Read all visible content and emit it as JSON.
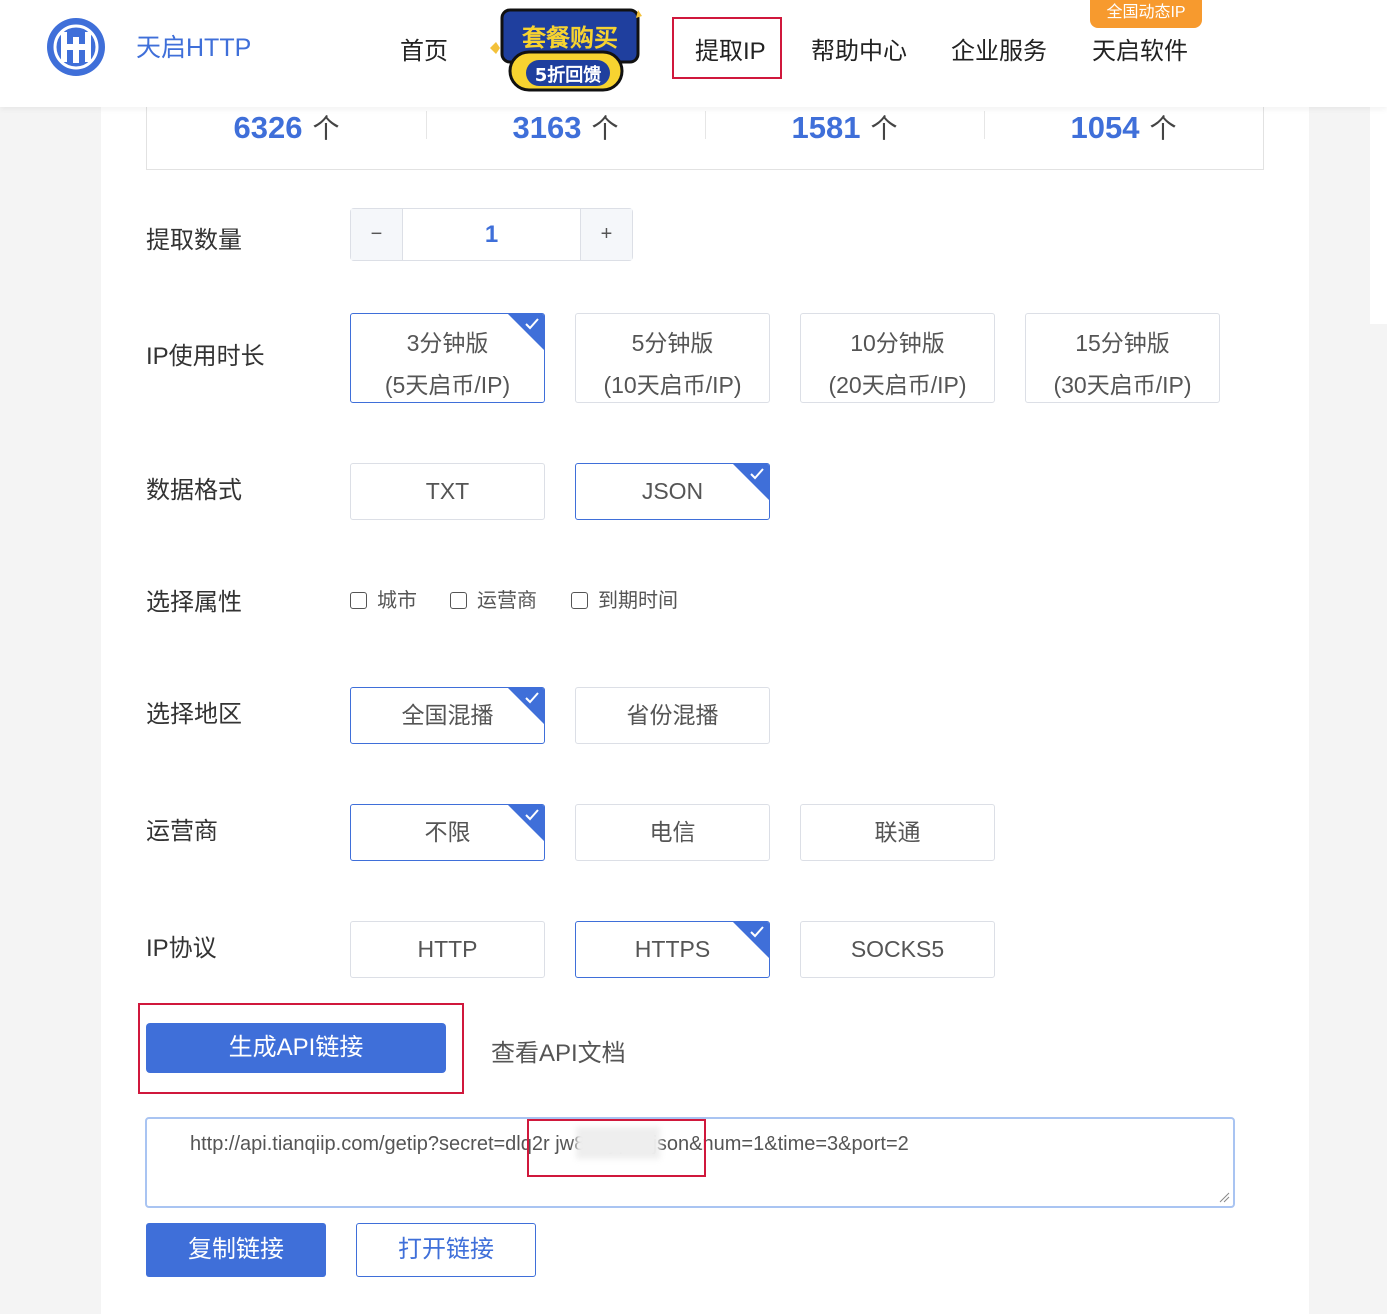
{
  "header": {
    "brand": "天启HTTP",
    "nav": [
      "首页",
      "提取IP",
      "帮助中心",
      "企业服务",
      "天启软件"
    ],
    "active_nav": "提取IP",
    "promo_line1": "套餐购买",
    "promo_line2": "5折回馈",
    "badge": "全国动态IP",
    "colors": {
      "accent": "#3f6fd9",
      "highlight": "#d0183c",
      "badge": "#f79a2e"
    }
  },
  "stats": [
    {
      "value": "6326",
      "unit": "个"
    },
    {
      "value": "3163",
      "unit": "个"
    },
    {
      "value": "1581",
      "unit": "个"
    },
    {
      "value": "1054",
      "unit": "个"
    }
  ],
  "form": {
    "quantity": {
      "label": "提取数量",
      "minus": "−",
      "plus": "+",
      "value": "1"
    },
    "duration": {
      "label": "IP使用时长",
      "options": [
        {
          "line1": "3分钟版",
          "line2": "(5天启币/IP)",
          "selected": true
        },
        {
          "line1": "5分钟版",
          "line2": "(10天启币/IP)",
          "selected": false
        },
        {
          "line1": "10分钟版",
          "line2": "(20天启币/IP)",
          "selected": false
        },
        {
          "line1": "15分钟版",
          "line2": "(30天启币/IP)",
          "selected": false
        }
      ]
    },
    "format": {
      "label": "数据格式",
      "options": [
        {
          "text": "TXT",
          "selected": false
        },
        {
          "text": "JSON",
          "selected": true
        }
      ]
    },
    "attributes": {
      "label": "选择属性",
      "options": [
        {
          "text": "城市",
          "checked": false
        },
        {
          "text": "运营商",
          "checked": false
        },
        {
          "text": "到期时间",
          "checked": false
        }
      ]
    },
    "region": {
      "label": "选择地区",
      "options": [
        {
          "text": "全国混播",
          "selected": true
        },
        {
          "text": "省份混播",
          "selected": false
        }
      ]
    },
    "carrier": {
      "label": "运营商",
      "options": [
        {
          "text": "不限",
          "selected": true
        },
        {
          "text": "电信",
          "selected": false
        },
        {
          "text": "联通",
          "selected": false
        }
      ]
    },
    "protocol": {
      "label": "IP协议",
      "options": [
        {
          "text": "HTTP",
          "selected": false
        },
        {
          "text": "HTTPS",
          "selected": true
        },
        {
          "text": "SOCKS5",
          "selected": false
        }
      ]
    }
  },
  "actions": {
    "generate": "生成API链接",
    "docs": "查看API文档",
    "url": "http://api.tianqiip.com/getip?secret=dlq2r          jw8i&type=json&num=1&time=3&port=2",
    "copy": "复制链接",
    "open": "打开链接"
  }
}
